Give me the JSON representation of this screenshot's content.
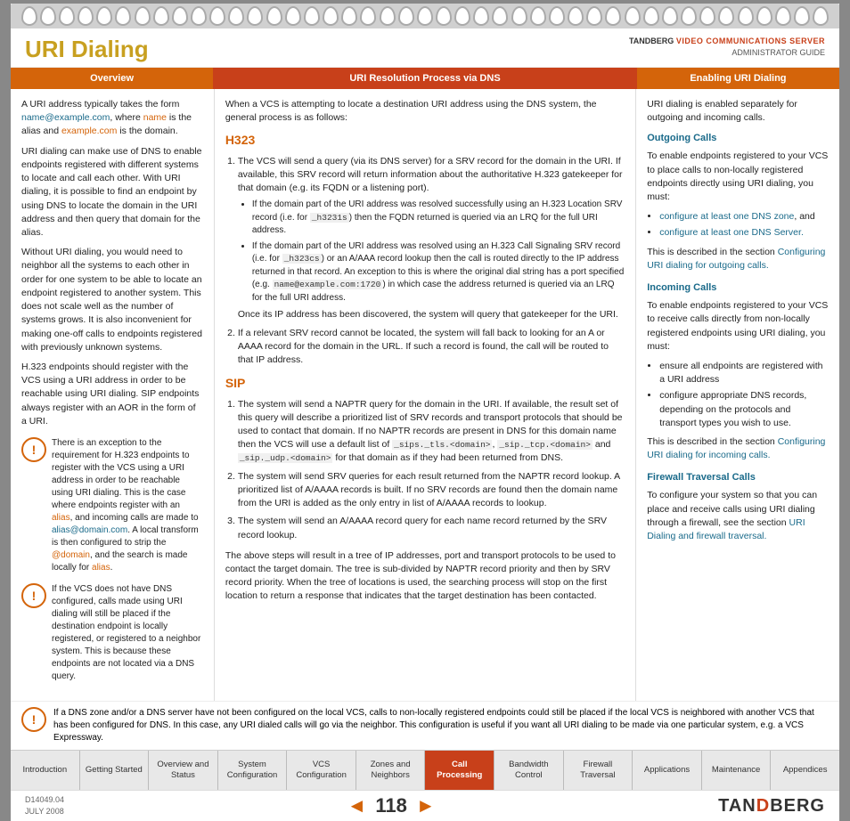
{
  "page": {
    "title": "URI Dialing",
    "doc_id": "D14049.04",
    "date": "JULY 2008",
    "brand": "TANDBERG",
    "product": "VIDEO COMMUNICATIONS SERVER",
    "guide": "ADMINISTRATOR GUIDE",
    "page_number": "118"
  },
  "sections": {
    "overview": "Overview",
    "uri_resolution": "URI Resolution Process via DNS",
    "enabling": "Enabling URI Dialing"
  },
  "overview_content": {
    "para1": "A URI address typically takes the form name@example.com, where name is the alias and example.com is the domain.",
    "para2": "URI dialing can make use of DNS to enable endpoints registered with different systems to locate and call each other. With URI dialing, it is possible to find an endpoint by using DNS to locate the domain in the URI address and then query that domain for the alias.",
    "para3": "Without URI dialing, you would need to neighbor all the systems to each other in order for one system to be able to locate an endpoint registered to another system. This does not scale well as the number of systems grows. It is also inconvenient for making one-off calls to endpoints registered with previously unknown systems.",
    "para4": "H.323 endpoints should register with the VCS using a URI address in order to be reachable using URI dialing. SIP endpoints always register with an AOR in the form of a URI.",
    "note1": "There is an exception to the requirement for H.323 endpoints to register with the VCS using a URI address in order to be reachable using URI dialing. This is the case where endpoints register with an alias, and incoming calls are made to alias@domain.com. A local transform is then configured to strip the @domain, and the search is made locally for alias.",
    "note2": "If the VCS does not have DNS configured, calls made using URI dialing will still be placed if the destination endpoint is locally registered, or registered to a neighbor system. This is because these endpoints are not located via a DNS query."
  },
  "uri_resolution": {
    "intro": "When a VCS is attempting to locate a destination URI address using the DNS system, the general process is as follows:",
    "h323_heading": "H323",
    "h323_items": [
      "The VCS will send a query (via its DNS server) for a SRV record for the domain in the URI. If available, this SRV record will return information about the authoritative H.323 gatekeeper for that domain (e.g. its FQDN or a listening port).",
      "If a relevant SRV record cannot be located, the system will fall back to looking for an A or AAAA record for the domain in the URL. If such a record is found, the call will be routed to that IP address."
    ],
    "h323_sub1": "If the domain part of the URI address was resolved successfully using an H.323 Location SRV record (i.e. for _h3231s) then the FQDN returned is queried via an LRQ for the full URI address.",
    "h323_sub2": "If the domain part of the URI address was resolved using an H.323 Call Signaling SRV record (i.e. for _h323cs) or an A/AAA record lookup then the call is routed directly to the IP address returned in that record. An exception to this is where the original dial string has a port specified (e.g. name@example.com:1720) in which case the address returned is queried via an LRQ for the full URI address.",
    "h323_sub3": "Once its IP address has been discovered, the system will query that gatekeeper for the URI.",
    "sip_heading": "SIP",
    "sip_items": [
      "The system will send a NAPTR query for the domain in the URI. If available, the result set of this query will describe a prioritized list of SRV records and transport protocols that should be used to contact that domain. If no NAPTR records are present in DNS for this domain name then the VCS will use a default list of _sips._tls.<domain>, _sip._tcp.<domain> and _sip._udp.<domain> for that domain as if they had been returned from DNS.",
      "The system will send SRV queries for each result returned from the NAPTR record lookup. A prioritized list of A/AAAA records is built. If no SRV records are found then the domain name from the URI is added as the only entry in list of A/AAAA records to lookup.",
      "The system will send an A/AAAA record query for each name record returned by the SRV record lookup."
    ],
    "sip_para": "The above steps will result in a tree of IP addresses, port and transport protocols to be used to contact the target domain. The tree is sub-divided by NAPTR record priority and then by SRV record priority. When the tree of locations is used, the searching process will stop on the first location to return a response that indicates that the target destination has been contacted."
  },
  "enabling": {
    "intro": "URI dialing is enabled separately for outgoing and incoming calls.",
    "outgoing_heading": "Outgoing Calls",
    "outgoing_para": "To enable endpoints registered to your VCS to place calls to non-locally registered endpoints directly using URI dialing, you must:",
    "outgoing_bullets": [
      "configure at least one DNS zone, and",
      "configure at least one DNS Server."
    ],
    "outgoing_link_text": "This is described in the section Configuring URI dialing for outgoing calls.",
    "incoming_heading": "Incoming Calls",
    "incoming_para": "To enable endpoints registered to your VCS to receive calls directly from non-locally registered endpoints using URI dialing, you must:",
    "incoming_bullets": [
      "ensure all endpoints are registered with a URI address",
      "configure appropriate DNS records, depending on the protocols and transport types you wish to use."
    ],
    "incoming_link_text": "This is described in the section Configuring URI dialing for incoming calls.",
    "firewall_heading": "Firewall Traversal Calls",
    "firewall_para": "To configure your system so that you can place and receive calls using URI dialing through a firewall, see the section URI Dialing and firewall traversal."
  },
  "bottom_note": "If a DNS zone and/or a DNS server have not been configured on the local VCS, calls to non-locally registered endpoints could still be placed if the local VCS is neighbored with another VCS that has been configured for DNS. In this case, any URI dialed calls will go via the neighbor. This configuration is useful if you want all URI dialing to be made via one particular system, e.g. a VCS Expressway.",
  "nav_tabs": [
    {
      "id": "introduction",
      "label": "Introduction"
    },
    {
      "id": "getting-started",
      "label": "Getting Started"
    },
    {
      "id": "overview-status",
      "label": "Overview and\nStatus"
    },
    {
      "id": "system-config",
      "label": "System\nConfiguration"
    },
    {
      "id": "vcs-config",
      "label": "VCS\nConfiguration"
    },
    {
      "id": "zones-neighbors",
      "label": "Zones and\nNeighbors"
    },
    {
      "id": "call-processing",
      "label": "Call\nProcessing",
      "active": true
    },
    {
      "id": "bandwidth-control",
      "label": "Bandwidth\nControl"
    },
    {
      "id": "firewall-traversal",
      "label": "Firewall\nTraversal"
    },
    {
      "id": "applications",
      "label": "Applications"
    },
    {
      "id": "maintenance",
      "label": "Maintenance"
    },
    {
      "id": "appendices",
      "label": "Appendices"
    }
  ]
}
